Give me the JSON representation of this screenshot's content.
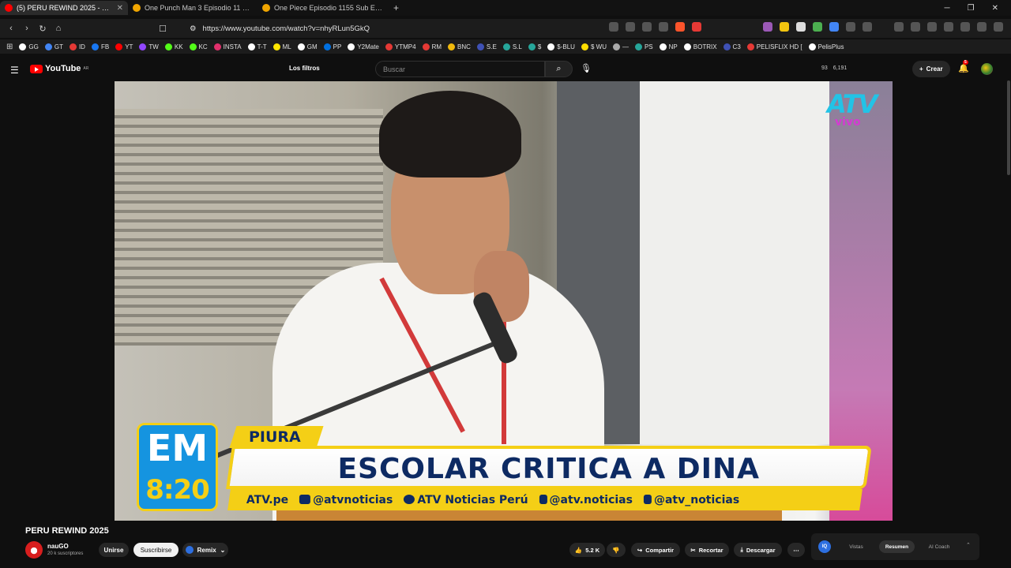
{
  "browser": {
    "tabs": [
      {
        "title": "(5) PERU REWIND 2025 - You",
        "active": true
      },
      {
        "title": "One Punch Man 3 Episodio 11 Sub E",
        "active": false
      },
      {
        "title": "One Piece Episodio 1155 Sub Españo",
        "active": false
      }
    ],
    "new_tab": "+",
    "url": "https://www.youtube.com/watch?v=nhyRLun5GkQ",
    "bookmarks": [
      {
        "label": "GG",
        "color": "#ffffff"
      },
      {
        "label": "GT",
        "color": "#4285f4"
      },
      {
        "label": "ID",
        "color": "#e53935"
      },
      {
        "label": "FB",
        "color": "#1877f2"
      },
      {
        "label": "YT",
        "color": "#ff0000"
      },
      {
        "label": "TW",
        "color": "#9146ff"
      },
      {
        "label": "KK",
        "color": "#53fc18"
      },
      {
        "label": "KC",
        "color": "#53fc18"
      },
      {
        "label": "INSTA",
        "color": "#e1306c"
      },
      {
        "label": "T-T",
        "color": "#ffffff"
      },
      {
        "label": "ML",
        "color": "#ffe600"
      },
      {
        "label": "GM",
        "color": "#ffffff"
      },
      {
        "label": "PP",
        "color": "#0070e0"
      },
      {
        "label": "Y2Mate",
        "color": "#ffffff"
      },
      {
        "label": "YTMP4",
        "color": "#e53935"
      },
      {
        "label": "RM",
        "color": "#e53935"
      },
      {
        "label": "BNC",
        "color": "#f0b90b"
      },
      {
        "label": "S.E",
        "color": "#3f51b5"
      },
      {
        "label": "S.L",
        "color": "#26a69a"
      },
      {
        "label": "$",
        "color": "#26a69a"
      },
      {
        "label": "$-BLU",
        "color": "#ffffff"
      },
      {
        "label": "$ WU",
        "color": "#ffdd00"
      },
      {
        "label": "—",
        "color": "#aaaaaa"
      },
      {
        "label": "PS",
        "color": "#26a69a"
      },
      {
        "label": "NP",
        "color": "#ffffff"
      },
      {
        "label": "BOTRIX",
        "color": "#ffffff"
      },
      {
        "label": "C3",
        "color": "#3f51b5"
      },
      {
        "label": "PELISFLIX HD [",
        "color": "#e53935"
      },
      {
        "label": "PelisPlus",
        "color": "#ffffff"
      }
    ]
  },
  "youtube": {
    "logo_text": "YouTube",
    "logo_region": "AR",
    "filters_label": "Los filtros",
    "search_placeholder": "Buscar",
    "stat_a": "93",
    "stat_b": "6,191",
    "create_label": "Crear",
    "notifications": "5"
  },
  "video_overlay": {
    "channel_logo": "ATV",
    "live_tag": "vivo",
    "program": "EM",
    "time": "8:20",
    "location": "PIURA",
    "headline": "ESCOLAR CRITICA A DINA",
    "social": [
      "ATV.pe",
      "@atvnoticias",
      "ATV Noticias Perú",
      "@atv.noticias",
      "@atv_noticias"
    ]
  },
  "video_info": {
    "title": "PERU REWIND 2025",
    "channel": "nauGO",
    "subscribers": "20 k suscriptores",
    "join_label": "Unirse",
    "subscribe_label": "Suscribirse",
    "remix_label": "Remix",
    "likes": "5.2 K",
    "share_label": "Compartir",
    "clip_label": "Recortar",
    "download_label": "Descargar",
    "ai_panel": {
      "tabs": [
        "Vistas",
        "Resumen",
        "AI Coach"
      ],
      "active": "Resumen"
    }
  }
}
